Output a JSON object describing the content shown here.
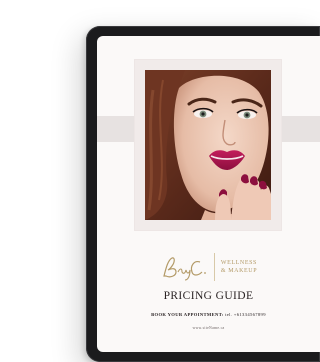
{
  "brand": {
    "logo_text": "Beauty Co",
    "tagline": [
      "WELLNESS",
      "& MAKEUP"
    ]
  },
  "document": {
    "title": "PRICING GUIDE",
    "appointment_label": "BOOK YOUR APPOINTMENT:",
    "appointment_phone": "tel. +61334567899",
    "website": "www.siteName.ca"
  },
  "colors": {
    "accent_gold": "#b39a67",
    "band": "#e7e2e1",
    "lipstick": "#b0164f",
    "device": "#1b1b1d"
  },
  "icons": {
    "brand_mark": "script-logo"
  }
}
